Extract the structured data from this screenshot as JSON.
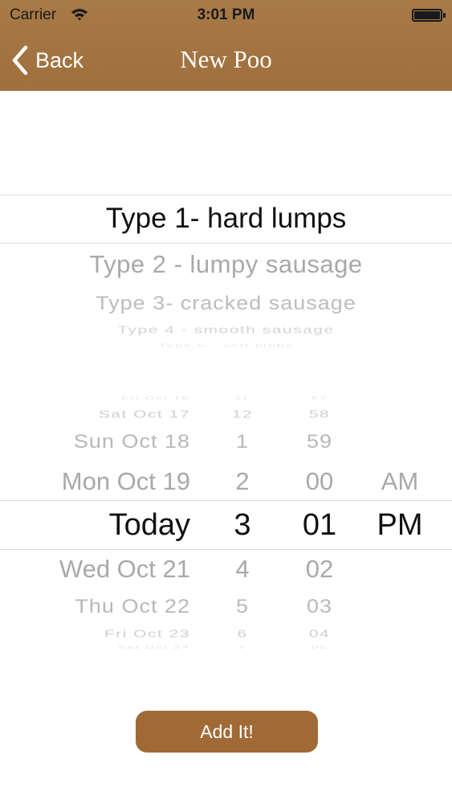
{
  "status_bar": {
    "carrier": "Carrier",
    "time": "3:01 PM",
    "wifi_icon": "wifi-icon",
    "battery_icon": "battery-icon"
  },
  "nav": {
    "back_label": "Back",
    "title": "New Poo",
    "back_icon": "chevron-left-icon"
  },
  "colors": {
    "header": "#a87a48",
    "button": "#a06a36",
    "selection_line": "#d9d9d9"
  },
  "type_picker": {
    "selected": "Type 1- hard lumps",
    "options": [
      "Type 2 - lumpy sausage",
      "Type 3- cracked sausage",
      "Type 4 - smooth sausage",
      "Type 5 - soft blobs"
    ]
  },
  "date_picker": {
    "days": {
      "above": [
        "Fri Oct 16",
        "Sat Oct 17",
        "Sun Oct 18",
        "Mon Oct 19"
      ],
      "selected": "Today",
      "below": [
        "Wed Oct 21",
        "Thu Oct 22",
        "Fri Oct 23",
        "Sat Oct 24"
      ]
    },
    "hours": {
      "above": [
        "11",
        "12",
        "1",
        "2"
      ],
      "selected": "3",
      "below": [
        "4",
        "5",
        "6",
        "7"
      ]
    },
    "minutes": {
      "above": [
        "57",
        "58",
        "59",
        "00"
      ],
      "selected": "01",
      "below": [
        "02",
        "03",
        "04",
        "05"
      ]
    },
    "ampm": {
      "above": "AM",
      "selected": "PM"
    }
  },
  "add_button": {
    "label": "Add It!"
  }
}
